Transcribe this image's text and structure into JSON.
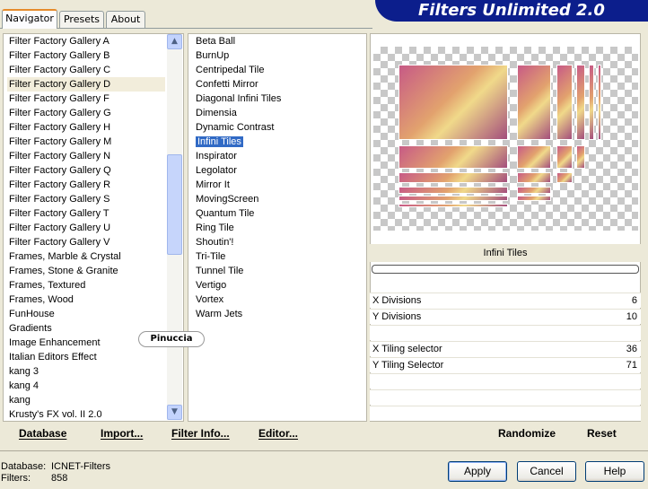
{
  "tabs": [
    "Navigator",
    "Presets",
    "About"
  ],
  "title": "Filters Unlimited 2.0",
  "categories": [
    "Filter Factory Gallery A",
    "Filter Factory Gallery B",
    "Filter Factory Gallery C",
    "Filter Factory Gallery D",
    "Filter Factory Gallery F",
    "Filter Factory Gallery G",
    "Filter Factory Gallery H",
    "Filter Factory Gallery M",
    "Filter Factory Gallery N",
    "Filter Factory Gallery Q",
    "Filter Factory Gallery R",
    "Filter Factory Gallery S",
    "Filter Factory Gallery T",
    "Filter Factory Gallery U",
    "Filter Factory Gallery V",
    "Frames, Marble & Crystal",
    "Frames, Stone & Granite",
    "Frames, Textured",
    "Frames, Wood",
    "FunHouse",
    "Gradients",
    "Image Enhancement",
    "Italian Editors Effect",
    "kang 3",
    "kang 4",
    "kang",
    "Krusty's FX vol. II 2.0"
  ],
  "selected_category": "Filter Factory Gallery D",
  "filters": [
    "Beta Ball",
    "BurnUp",
    "Centripedal Tile",
    "Confetti Mirror",
    "Diagonal Infini Tiles",
    "Dimensia",
    "Dynamic Contrast",
    "Infini Tiles",
    "Inspirator",
    "Legolator",
    "Mirror It",
    "MovingScreen",
    "Quantum Tile",
    "Ring Tile",
    "Shoutin'!",
    "Tri-Tile",
    "Tunnel Tile",
    "Vertigo",
    "Vortex",
    "Warm Jets"
  ],
  "selected_filter": "Infini Tiles",
  "watermark": "Pinuccia",
  "filter_name": "Infini Tiles",
  "params": [
    {
      "label": "X Divisions",
      "value": "6"
    },
    {
      "label": "Y Divisions",
      "value": "10"
    },
    {
      "label": "",
      "value": ""
    },
    {
      "label": "X Tiling selector",
      "value": "36"
    },
    {
      "label": "Y Tiling Selector",
      "value": "71"
    }
  ],
  "bottom_links": {
    "database": "Database",
    "import": "Import...",
    "filter_info": "Filter Info...",
    "editor": "Editor...",
    "randomize": "Randomize",
    "reset": "Reset"
  },
  "status": {
    "database_label": "Database:",
    "database_value": "ICNET-Filters",
    "filters_label": "Filters:",
    "filters_value": "858"
  },
  "buttons": {
    "apply": "Apply",
    "cancel": "Cancel",
    "help": "Help"
  },
  "colors": {
    "banner": "#0c1e8c",
    "selection": "#316ac5",
    "tab_highlight": "#e68b2c"
  }
}
